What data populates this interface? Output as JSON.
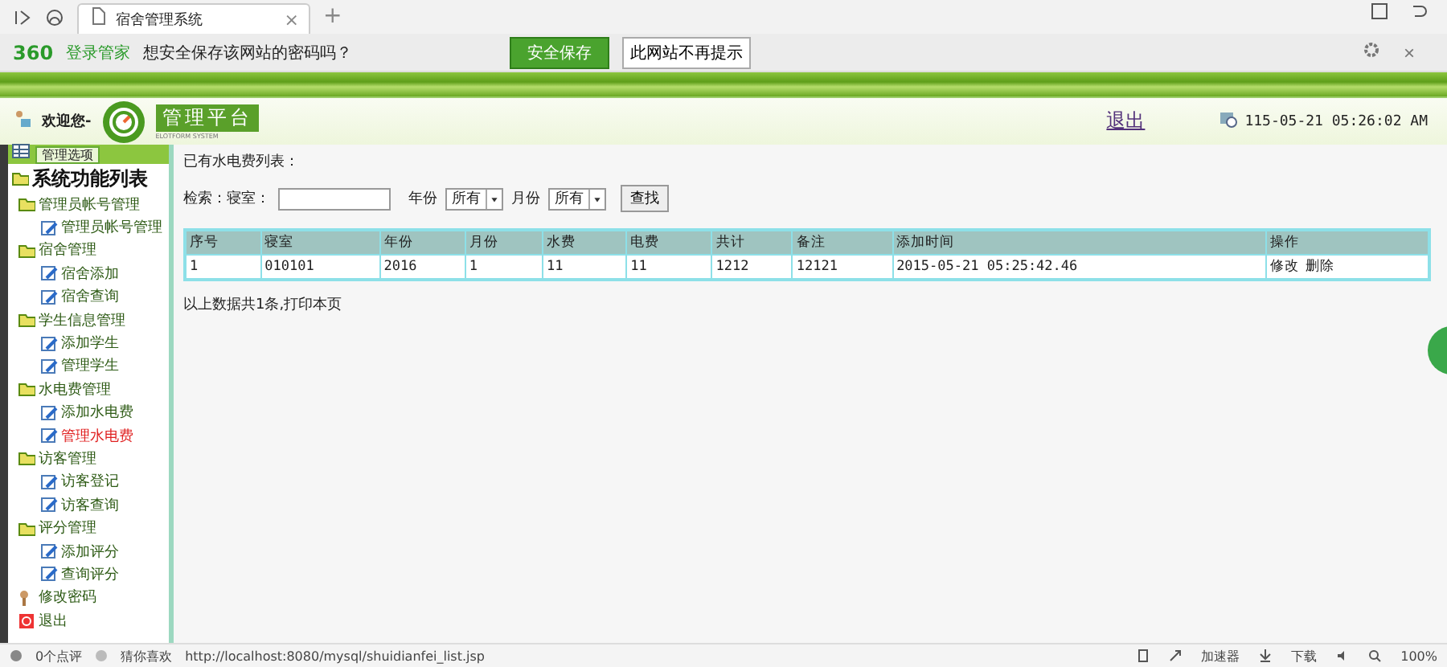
{
  "browser": {
    "tab_title": "宿舍管理系统",
    "tab_close": "×",
    "new_tab": "+"
  },
  "notice_bar": {
    "brand": "360",
    "product": "登录管家",
    "message": "想安全保存该网站的密码吗？",
    "save_button": "安全保存",
    "never_button": "此网站不再提示",
    "close": "×"
  },
  "header": {
    "welcome": "欢迎您-",
    "platform_title": "管理平台",
    "platform_subtitle": "ELOTFORM SYSTEM",
    "logout": "退出",
    "datetime": "115-05-21 05:26:02 AM"
  },
  "sidebar": {
    "tab": "管理选项",
    "root": "系统功能列表",
    "items": [
      {
        "label": "管理员帐号管理",
        "kind": "folder",
        "children": [
          {
            "label": "管理员帐号管理",
            "kind": "page",
            "selected": false
          }
        ]
      },
      {
        "label": "宿舍管理",
        "kind": "folder",
        "children": [
          {
            "label": "宿舍添加",
            "kind": "page",
            "selected": false
          },
          {
            "label": "宿舍查询",
            "kind": "page",
            "selected": false
          }
        ]
      },
      {
        "label": "学生信息管理",
        "kind": "folder",
        "children": [
          {
            "label": "添加学生",
            "kind": "page",
            "selected": false
          },
          {
            "label": "管理学生",
            "kind": "page",
            "selected": false
          }
        ]
      },
      {
        "label": "水电费管理",
        "kind": "folder",
        "children": [
          {
            "label": "添加水电费",
            "kind": "page",
            "selected": false
          },
          {
            "label": "管理水电费",
            "kind": "page",
            "selected": true
          }
        ]
      },
      {
        "label": "访客管理",
        "kind": "folder",
        "children": [
          {
            "label": "访客登记",
            "kind": "page",
            "selected": false
          },
          {
            "label": "访客查询",
            "kind": "page",
            "selected": false
          }
        ]
      },
      {
        "label": "评分管理",
        "kind": "folder",
        "children": [
          {
            "label": "添加评分",
            "kind": "page",
            "selected": false
          },
          {
            "label": "查询评分",
            "kind": "page",
            "selected": false
          }
        ]
      },
      {
        "label": "修改密码",
        "kind": "key"
      },
      {
        "label": "退出",
        "kind": "exit"
      }
    ]
  },
  "main": {
    "heading": "已有水电费列表：",
    "search": {
      "label": "检索：寝室：",
      "year_label": "年份",
      "year_value": "所有",
      "month_label": "月份",
      "month_value": "所有",
      "button": "查找"
    },
    "table": {
      "columns": [
        "序号",
        "寝室",
        "年份",
        "月份",
        "水费",
        "电费",
        "共计",
        "备注",
        "添加时间",
        "操作"
      ],
      "rows": [
        {
          "cells": [
            "1",
            "010101",
            "2016",
            "1",
            "11",
            "11",
            "1212",
            "12121",
            "2015-05-21 05:25:42.46"
          ],
          "actions": [
            "修改",
            "删除"
          ]
        }
      ]
    },
    "footer": {
      "summary": "以上数据共1条,",
      "print": "打印本页"
    }
  },
  "status_bar": {
    "comments": "0个点评",
    "guess": "猜你喜欢",
    "url": "http://localhost:8080/mysql/shuidianfei_list.jsp",
    "accelerator": "加速器",
    "download": "下载",
    "zoom": "100%"
  }
}
